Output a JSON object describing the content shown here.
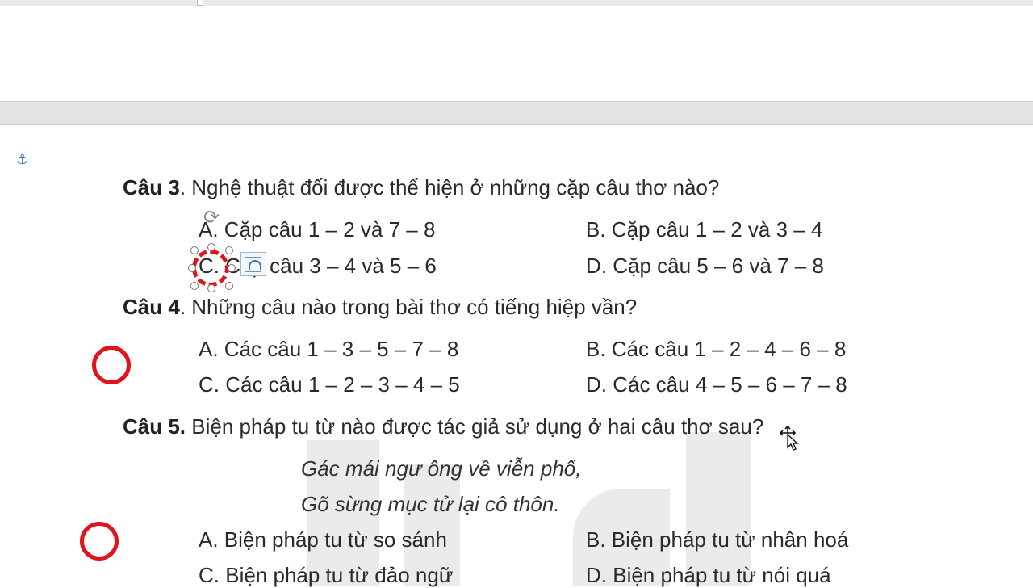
{
  "questions": [
    {
      "label": "Câu 3",
      "text": ". Nghệ thuật đối được thể hiện ở những cặp câu thơ nào?",
      "options": {
        "a": "A. Cặp câu 1 – 2 và 7 – 8",
        "b": "B. Cặp câu 1 – 2 và 3 – 4",
        "c": "C. Cặp câu 3 – 4 và 5 – 6",
        "d": "D. Cặp câu 5 – 6 và 7 – 8"
      }
    },
    {
      "label": "Câu 4",
      "text": ". Những câu nào trong bài thơ có tiếng hiệp vần?",
      "options": {
        "a": "A. Các câu 1 – 3 – 5 – 7 – 8",
        "b": "B. Các câu 1 – 2 – 4 – 6 – 8",
        "c": "C. Các câu 1 – 2 – 3 – 4 – 5",
        "d": "D. Các câu 4 – 5 – 6 – 7 – 8"
      }
    },
    {
      "label": "Câu 5.",
      "text": " Biện pháp tu từ nào được tác giả sử dụng ở hai câu thơ sau?",
      "poem": [
        "Gác mái ngư ông về viễn phố,",
        "Gõ sừng mục tử lại cô thôn."
      ],
      "options": {
        "a": "A. Biện pháp tu từ so sánh",
        "b": "B. Biện pháp tu từ nhân hoá",
        "c": "C. Biện pháp tu từ đảo ngữ",
        "d": "D. Biện pháp tu từ nói quá"
      }
    }
  ],
  "icons": {
    "anchor": "anchor-icon",
    "rotate": "rotate-handle-icon",
    "layout": "layout-options-icon",
    "cursor": "move-cursor-icon"
  },
  "colors": {
    "annotation_red": "#e1141b",
    "anchor_blue": "#3b6fb6"
  }
}
